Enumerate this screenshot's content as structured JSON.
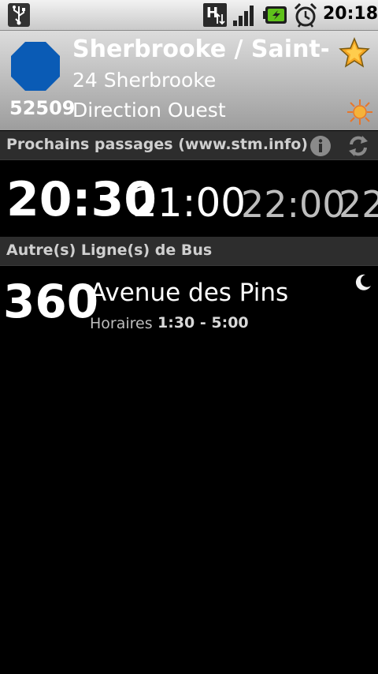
{
  "status_bar": {
    "time": "20:18",
    "icons": [
      "usb-icon",
      "h-network-icon",
      "signal-icon",
      "battery-charging-icon",
      "alarm-icon"
    ]
  },
  "stop": {
    "name": "Sherbrooke / Saint-L",
    "code": "52509",
    "route": "24 Sherbrooke",
    "direction": "Direction Ouest",
    "sign_color": "#0a5bb5",
    "favorite_icon": "star-icon",
    "period_icon": "sun-icon"
  },
  "next_passages": {
    "title": "Prochains passages (www.stm.info)",
    "times": [
      "20:30",
      "21:00",
      "22:00",
      "22"
    ],
    "icons": [
      "info-icon",
      "refresh-icon"
    ]
  },
  "other_lines": {
    "title": "Autre(s) Ligne(s) de Bus",
    "items": [
      {
        "number": "360",
        "name": "Avenue des Pins",
        "schedule_label": "Horaires",
        "schedule_value": "1:30 - 5:00",
        "icon": "moon-icon"
      }
    ]
  }
}
